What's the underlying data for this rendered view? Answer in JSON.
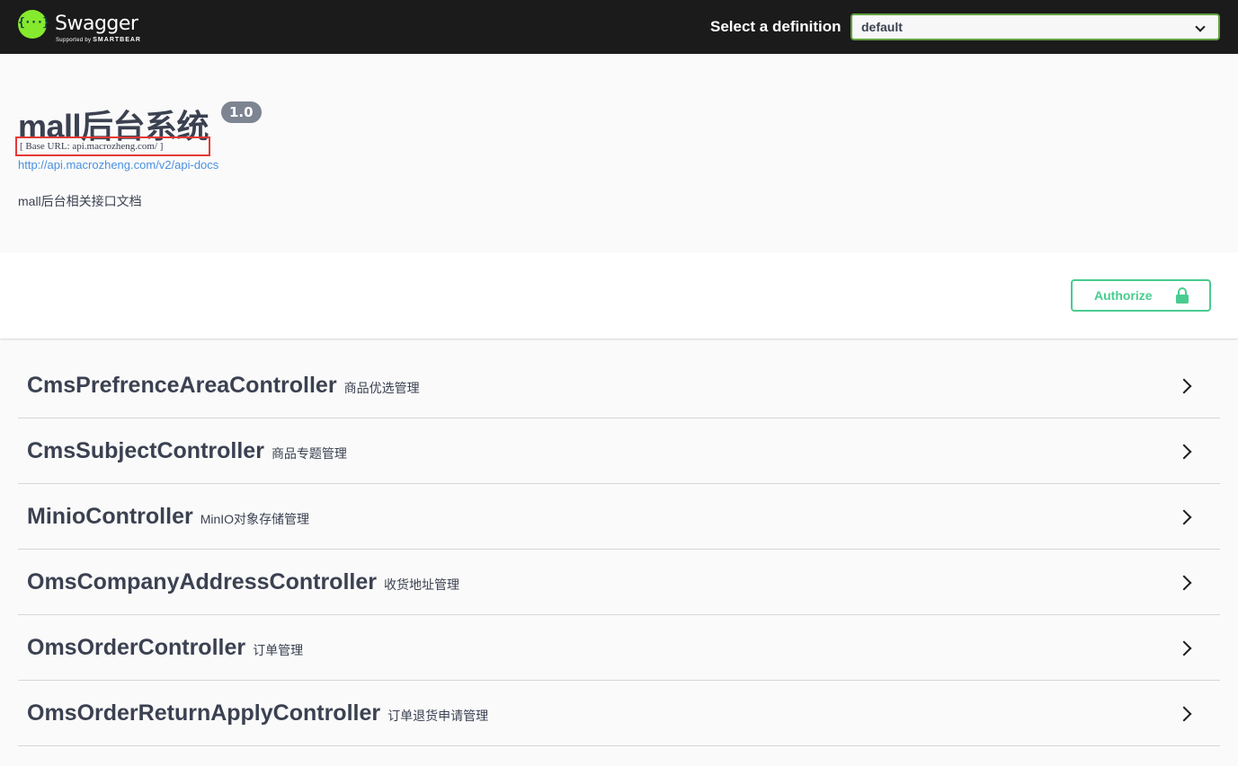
{
  "topbar": {
    "logo_name": "Swagger",
    "logo_sub_prefix": "Supported by",
    "logo_sub_brand": "SMARTBEAR",
    "definition_label": "Select a definition",
    "definition_value": "default"
  },
  "info": {
    "title": "mall后台系统",
    "version": "1.0",
    "base_url": "[ Base URL: api.macrozheng.com/ ]",
    "docs_link": "http://api.macrozheng.com/v2/api-docs",
    "description": "mall后台相关接口文档"
  },
  "auth": {
    "button_label": "Authorize",
    "icon": "lock-icon"
  },
  "tags": [
    {
      "name": "CmsPrefrenceAreaController",
      "description": "商品优选管理"
    },
    {
      "name": "CmsSubjectController",
      "description": "商品专题管理"
    },
    {
      "name": "MinioController",
      "description": "MinIO对象存储管理"
    },
    {
      "name": "OmsCompanyAddressController",
      "description": "收货地址管理"
    },
    {
      "name": "OmsOrderController",
      "description": "订单管理"
    },
    {
      "name": "OmsOrderReturnApplyController",
      "description": "订单退货申请管理"
    }
  ],
  "colors": {
    "topbar": "#1b1b1b",
    "accent_green": "#49cc90",
    "select_border": "#62a03f",
    "link": "#4990e2",
    "highlight_box": "#e53935"
  }
}
